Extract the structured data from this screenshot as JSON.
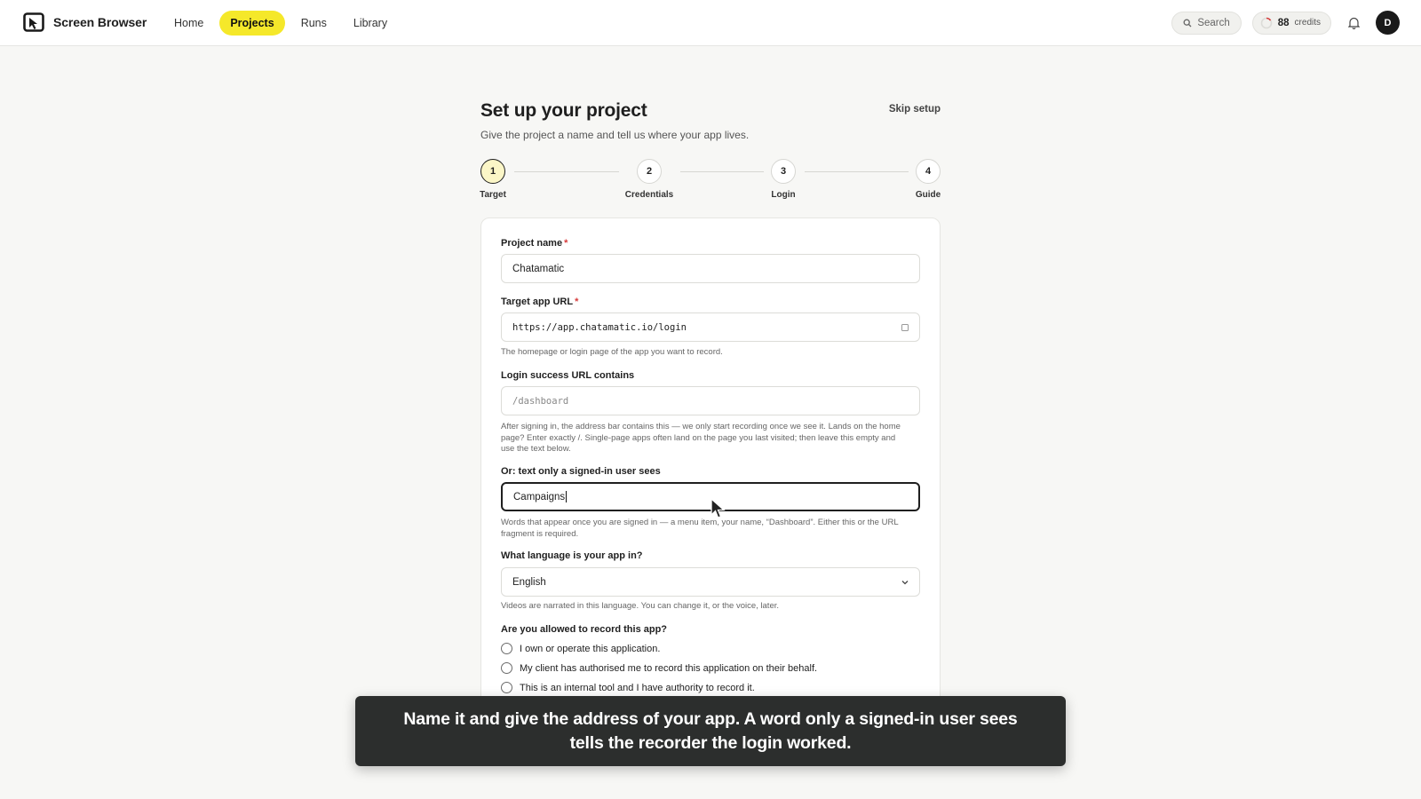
{
  "app": {
    "name": "Screen Browser"
  },
  "nav": {
    "items": [
      {
        "label": "Home",
        "active": false
      },
      {
        "label": "Projects",
        "active": true
      },
      {
        "label": "Runs",
        "active": false
      },
      {
        "label": "Library",
        "active": false
      }
    ]
  },
  "topbar": {
    "search_label": "Search",
    "credits_value": "88",
    "credits_unit": "credits",
    "avatar_initial": "D"
  },
  "page": {
    "title": "Set up your project",
    "subtitle": "Give the project a name and tell us where your app lives.",
    "skip_label": "Skip setup"
  },
  "steps": [
    {
      "number": "1",
      "label": "Target",
      "active": true
    },
    {
      "number": "2",
      "label": "Credentials",
      "active": false
    },
    {
      "number": "3",
      "label": "Login",
      "active": false
    },
    {
      "number": "4",
      "label": "Guide",
      "active": false
    }
  ],
  "form": {
    "project_name": {
      "label": "Project name",
      "required_mark": "*",
      "value": "Chatamatic"
    },
    "target_url": {
      "label": "Target app URL",
      "required_mark": "*",
      "value": "https://app.chatamatic.io/login",
      "hint": "The homepage or login page of the app you want to record."
    },
    "login_success_url": {
      "label": "Login success URL contains",
      "placeholder": "/dashboard",
      "hint": "After signing in, the address bar contains this — we only start recording once we see it. Lands on the home page? Enter exactly /. Single-page apps often land on the page you last visited; then leave this empty and use the text below."
    },
    "signed_in_text": {
      "label": "Or: text only a signed-in user sees",
      "value": "Campaigns",
      "hint": "Words that appear once you are signed in — a menu item, your name, “Dashboard”. Either this or the URL fragment is required."
    },
    "language": {
      "label": "What language is your app in?",
      "selected": "English",
      "hint": "Videos are narrated in this language. You can change it, or the voice, later."
    },
    "permission": {
      "label": "Are you allowed to record this app?",
      "options": [
        "I own or operate this application.",
        "My client has authorised me to record this application on their behalf.",
        "This is an internal tool and I have authority to record it."
      ]
    }
  },
  "caption": {
    "text": "Name it and give the address of your app. A word only a signed-in user sees tells the recorder the login worked."
  },
  "colors": {
    "accent": "#f5e82a",
    "step_active_bg": "#fbf6c7",
    "required": "#d63a3a",
    "caption_bg": "#2c2e2d"
  }
}
